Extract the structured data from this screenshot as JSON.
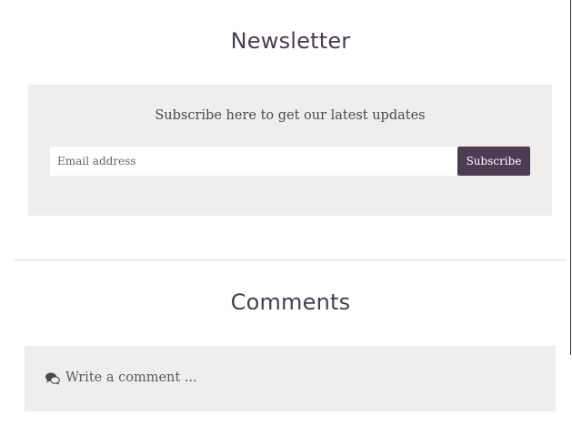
{
  "newsletter": {
    "title": "Newsletter",
    "subtitle": "Subscribe here to get our latest updates",
    "email_placeholder": "Email address",
    "subscribe_label": "Subscribe"
  },
  "comments": {
    "title": "Comments",
    "prompt": "Write a comment ...",
    "icon": "comments-icon"
  },
  "colors": {
    "accent": "#4d3c54",
    "title_text": "#4a3b52",
    "panel_bg": "#efeeec"
  }
}
